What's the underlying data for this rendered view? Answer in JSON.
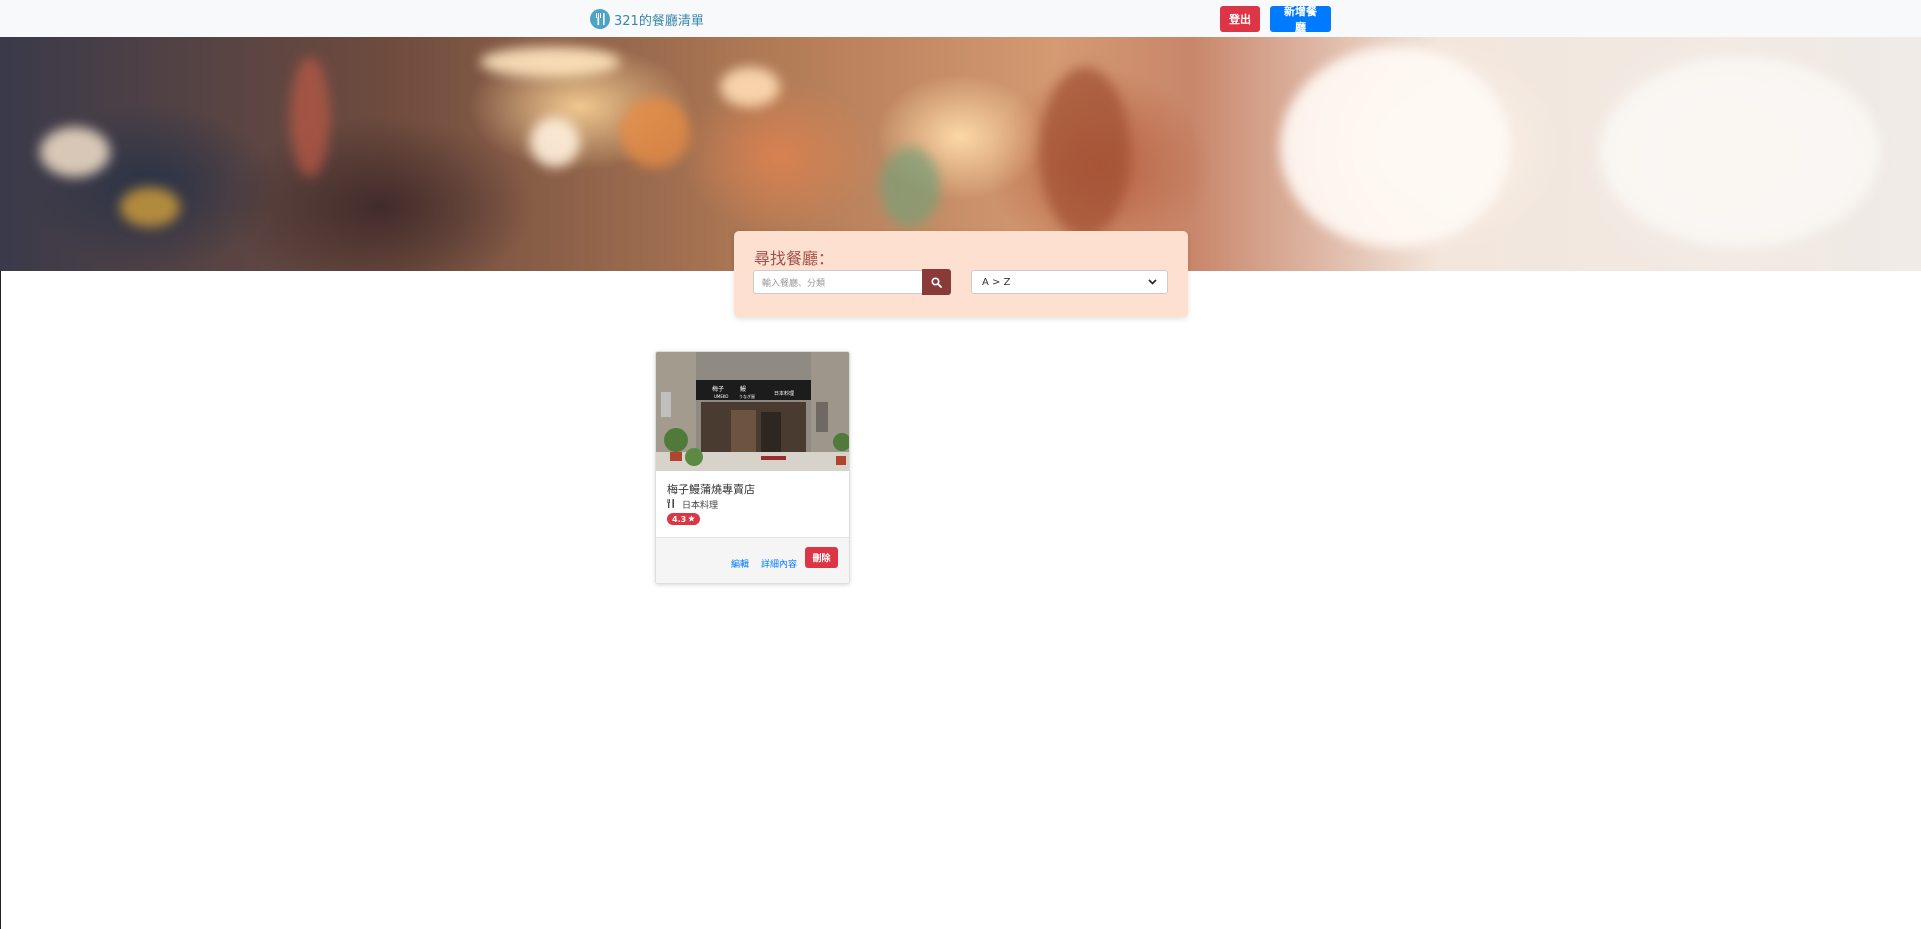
{
  "navbar": {
    "brand_text": "321的餐廳清單",
    "brand_icon": "utensils-icon",
    "logout_label": "登出",
    "new_restaurant_label": "新增餐廳"
  },
  "search": {
    "title": "尋找餐廳：",
    "placeholder": "輸入餐廳、分類",
    "button_icon": "search-icon",
    "sort_selected": "A > Z"
  },
  "restaurants": [
    {
      "name": "梅子鰻蒲燒專賣店",
      "category": "日本料理",
      "category_icon": "utensils-icon",
      "rating": "4.3",
      "rating_icon": "star-icon",
      "edit_label": "編輯",
      "detail_label": "詳細內容",
      "delete_label": "刪除",
      "image_sign_texts": [
        "梅子",
        "鰻",
        "UMEKO",
        "うなぎ屋",
        "日本料理"
      ]
    }
  ],
  "colors": {
    "navbar_bg": "#f8f9fa",
    "brand": "#3a87ad",
    "danger": "#dc3545",
    "primary": "#007bff",
    "search_panel_bg": "#fde0d0",
    "search_title": "#a0524b",
    "search_button": "#8b3a3a"
  }
}
